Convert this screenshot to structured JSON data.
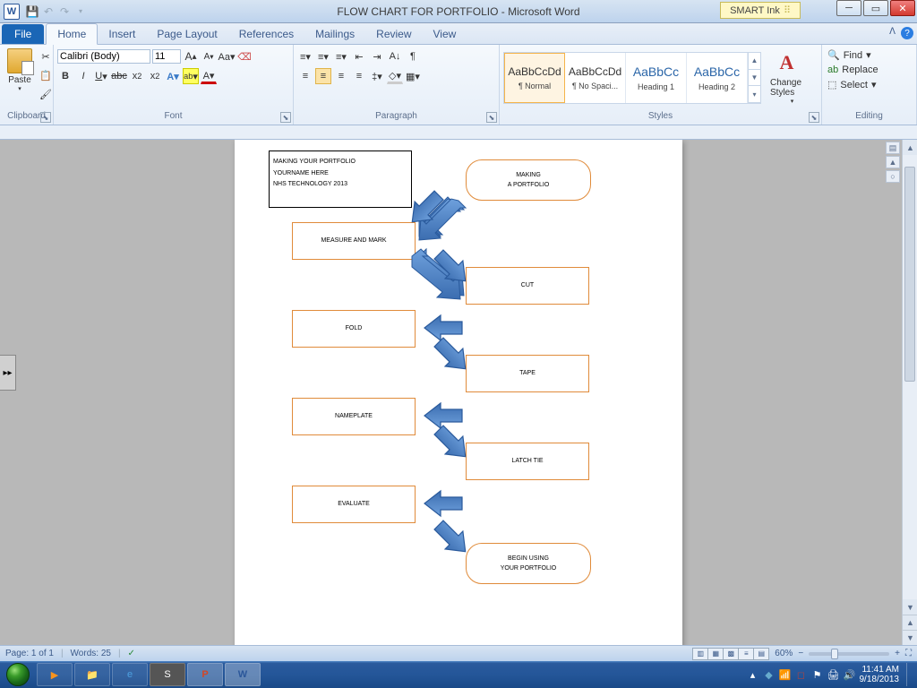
{
  "title": "FLOW CHART FOR PORTFOLIO - Microsoft Word",
  "smart_ink": "SMART Ink",
  "tabs": {
    "file": "File",
    "home": "Home",
    "insert": "Insert",
    "page_layout": "Page Layout",
    "references": "References",
    "mailings": "Mailings",
    "review": "Review",
    "view": "View"
  },
  "ribbon": {
    "clipboard": {
      "paste": "Paste",
      "label": "Clipboard"
    },
    "font": {
      "name": "Calibri (Body)",
      "size": "11",
      "label": "Font"
    },
    "paragraph": {
      "label": "Paragraph"
    },
    "styles": {
      "label": "Styles",
      "items": [
        {
          "preview": "AaBbCcDd",
          "name": "¶ Normal",
          "selected": true,
          "heading": false
        },
        {
          "preview": "AaBbCcDd",
          "name": "¶ No Spaci...",
          "selected": false,
          "heading": false
        },
        {
          "preview": "AaBbCc",
          "name": "Heading 1",
          "selected": false,
          "heading": true
        },
        {
          "preview": "AaBbCc",
          "name": "Heading 2",
          "selected": false,
          "heading": true
        }
      ],
      "change": "Change Styles"
    },
    "editing": {
      "find": "Find",
      "replace": "Replace",
      "select": "Select",
      "label": "Editing"
    }
  },
  "doc": {
    "info": {
      "l1": "MAKING YOUR PORTFOLIO",
      "l2": "YOURNAME HERE",
      "l3": "NHS TECHNOLOGY 2013"
    },
    "start": {
      "l1": "MAKING",
      "l2": "A PORTFOLIO"
    },
    "b1": "MEASURE AND MARK",
    "b2": "CUT",
    "b3": "FOLD",
    "b4": "TAPE",
    "b5": "NAMEPLATE",
    "b6": "LATCH TIE",
    "b7": "EVALUATE",
    "end": {
      "l1": "BEGIN USING",
      "l2": "YOUR PORTFOLIO"
    }
  },
  "status": {
    "page": "Page: 1 of 1",
    "words": "Words: 25",
    "zoom": "60%"
  },
  "clock": {
    "time": "11:41 AM",
    "date": "9/18/2013"
  }
}
